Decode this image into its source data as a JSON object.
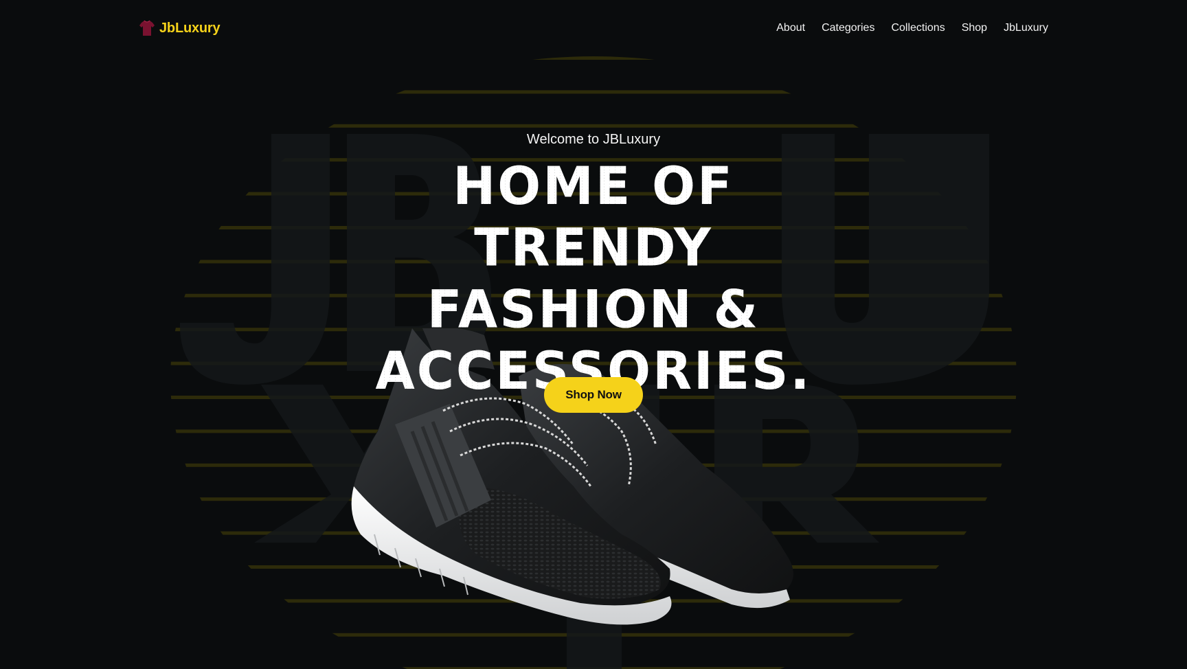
{
  "brand": {
    "name": "JbLuxury",
    "icon": "shirt-icon",
    "color": "#f5d21a",
    "icon_color": "#7a1230"
  },
  "nav": {
    "links": [
      "About",
      "Categories",
      "Collections",
      "Shop",
      "JbLuxury"
    ]
  },
  "hero": {
    "welcome": "Welcome to JBLuxury",
    "headline": "HOME OF TRENDY FASHION & ACCESSORIES.",
    "cta_label": "Shop Now",
    "watermark_text": "JBLUXURY",
    "image": "sneaker-image"
  },
  "colors": {
    "background": "#0a0c0d",
    "accent": "#f5d21a",
    "stripe": "#2d2b0a",
    "text": "#ffffff"
  }
}
